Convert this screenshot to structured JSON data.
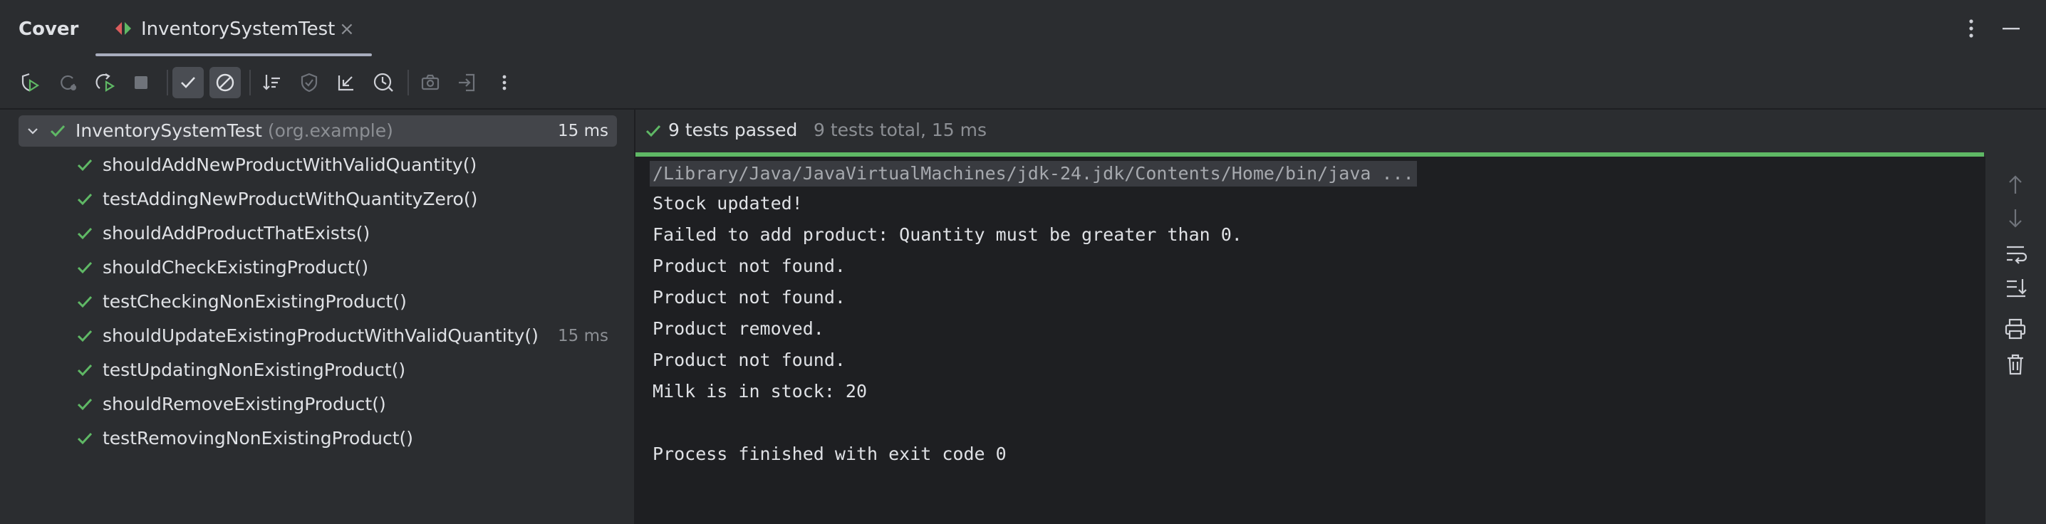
{
  "header": {
    "cover_tab": "Cover",
    "run_tab": "InventorySystemTest",
    "run_tab_close": "×"
  },
  "toolbar": {
    "buttons": [
      "rerun-icon",
      "rerun-failed-icon",
      "toggle-auto-test-icon",
      "stop-icon",
      "show-passed-icon",
      "show-ignored-icon",
      "sort-alphabetically-icon",
      "coverage-icon",
      "collapse-all-icon",
      "sort-by-duration-icon",
      "screenshot-icon",
      "import-tests-icon",
      "more-icon"
    ]
  },
  "tree": {
    "root": {
      "name": "InventorySystemTest",
      "package": "(org.example)",
      "duration": "15 ms"
    },
    "tests": [
      {
        "name": "shouldAddNewProductWithValidQuantity()",
        "duration": ""
      },
      {
        "name": "testAddingNewProductWithQuantityZero()",
        "duration": ""
      },
      {
        "name": "shouldAddProductThatExists()",
        "duration": ""
      },
      {
        "name": "shouldCheckExistingProduct()",
        "duration": ""
      },
      {
        "name": "testCheckingNonExistingProduct()",
        "duration": ""
      },
      {
        "name": "shouldUpdateExistingProductWithValidQuantity()",
        "duration": "15 ms"
      },
      {
        "name": "testUpdatingNonExistingProduct()",
        "duration": ""
      },
      {
        "name": "shouldRemoveExistingProduct()",
        "duration": ""
      },
      {
        "name": "testRemovingNonExistingProduct()",
        "duration": ""
      }
    ]
  },
  "status": {
    "passed": "9 tests passed",
    "total": "9 tests total, 15 ms"
  },
  "console": {
    "command": "/Library/Java/JavaVirtualMachines/jdk-24.jdk/Contents/Home/bin/java ...",
    "lines": [
      "Stock updated!",
      "Failed to add product: Quantity must be greater than 0.",
      "Product not found.",
      "Product not found.",
      "Product removed.",
      "Product not found.",
      "Milk is in stock: 20",
      "",
      "Process finished with exit code 0"
    ]
  },
  "colors": {
    "background": "#2b2d30",
    "console_background": "#1e1f22",
    "pass_green": "#5fb865",
    "text": "#dfe1e5",
    "muted_text": "#8c8f94"
  }
}
